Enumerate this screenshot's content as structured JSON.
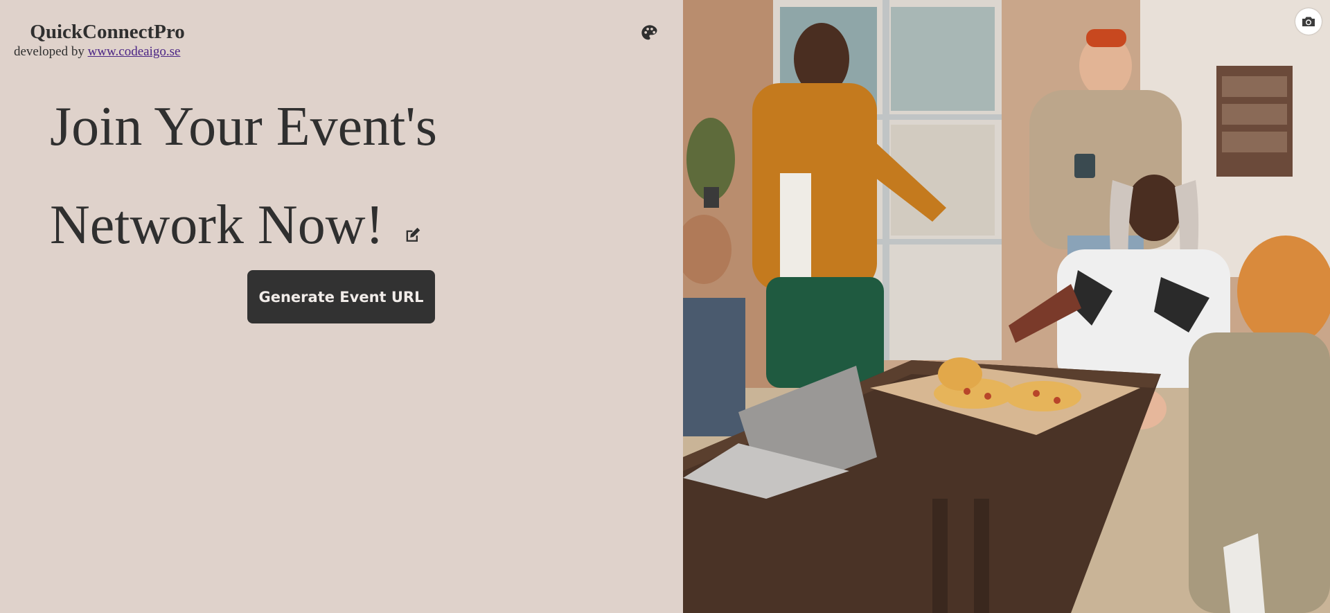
{
  "brand": {
    "title": "QuickConnectPro",
    "developed_by": "developed by",
    "link_text": "www.codeaigo.se"
  },
  "hero": {
    "headline_line1": "Join Your Event's",
    "headline_line2": "Network Now!",
    "generate_button_label": "Generate Event URL"
  },
  "icons": {
    "theme": "palette-icon",
    "edit": "edit-icon",
    "change_photo": "camera-icon"
  },
  "colors": {
    "background": "#dfd2cb",
    "text": "#2f2f2f",
    "button_bg": "#323232",
    "button_text": "#f1ece9",
    "link": "#4b2585"
  }
}
